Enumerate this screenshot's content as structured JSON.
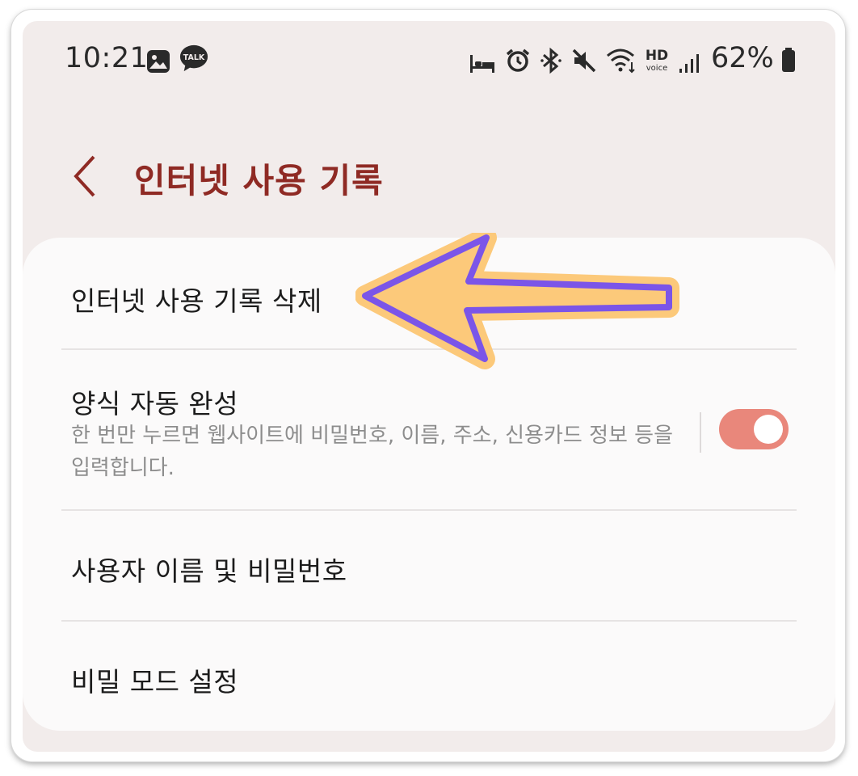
{
  "status_bar": {
    "time": "10:21",
    "left_icons": [
      "gallery-icon",
      "kakaotalk-icon"
    ],
    "kakaotalk_badge": "TALK",
    "right_icons": [
      "sleep-mode-icon",
      "alarm-icon",
      "bluetooth-icon",
      "mute-icon",
      "wifi-icon",
      "hd-voice-icon",
      "signal-icon",
      "battery-icon"
    ],
    "hd_label": "HD",
    "voice_label": "voice",
    "battery_percent": "62%"
  },
  "header": {
    "back_icon": "chevron-left-icon",
    "title": "인터넷 사용 기록"
  },
  "settings": {
    "items": [
      {
        "title": "인터넷 사용 기록 삭제"
      },
      {
        "title": "양식 자동 완성",
        "description": "한 번만 누르면 웹사이트에 비밀번호, 이름, 주소, 신용카드 정보 등을 입력합니다.",
        "toggle_on": true
      },
      {
        "title": "사용자 이름 및 비밀번호"
      },
      {
        "title": "비밀 모드 설정"
      }
    ]
  },
  "annotation": {
    "type": "arrow",
    "fill_color": "#fcc97a",
    "stroke_color": "#7b55e8"
  },
  "colors": {
    "accent": "#8f2a24",
    "toggle_on": "#e9877b",
    "screen_bg": "#f2eceb",
    "card_bg": "#fbfafa"
  }
}
